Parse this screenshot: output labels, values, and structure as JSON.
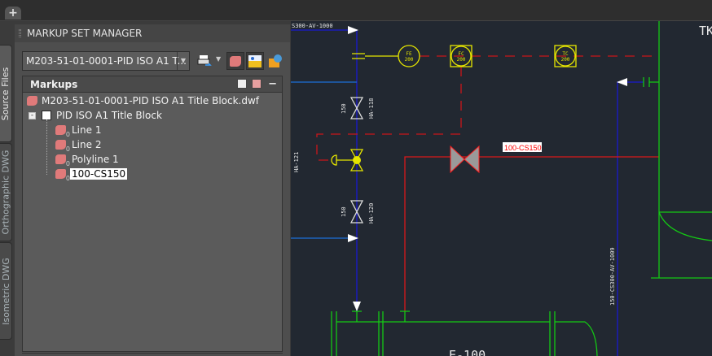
{
  "window": {
    "new_tab_label": "+"
  },
  "side_tabs": [
    {
      "label": "Source Files",
      "active": true
    },
    {
      "label": "Orthographic DWG",
      "active": false
    },
    {
      "label": "Isometric DWG",
      "active": false
    }
  ],
  "panel": {
    "title": "MARKUP SET MANAGER",
    "set_select": {
      "value": "M203-51-01-0001-PID ISO A1 T..."
    },
    "toolbar": [
      "publish-icon",
      "markup-icon",
      "view-sheet-icon",
      "republish-icon"
    ],
    "markups": {
      "header": "Markups",
      "collapse_label": "−",
      "tree": {
        "file": "M203-51-01-0001-PID ISO A1 Title Block.dwf",
        "sheet": "PID ISO A1 Title Block",
        "items": [
          "Line 1",
          "Line 2",
          "Polyline 1",
          "100-CS150"
        ],
        "selected": "100-CS150"
      }
    }
  },
  "drawing": {
    "colors": {
      "background": "#222831",
      "process": "#1a1ad0",
      "signal": "#c8161b",
      "instrument": "#e6e600",
      "equipment": "#14c814",
      "markup": "#ff0000"
    },
    "labels": {
      "top_line": "S300-AV-1000",
      "fe": [
        "FE",
        "200"
      ],
      "fc": [
        "FC",
        "200"
      ],
      "tc": [
        "TC",
        "200"
      ],
      "valve1_size": "150",
      "valve1_tag": "HA-118",
      "valve2_tag": "HA-121",
      "valve3_size": "150",
      "valve3_tag": "HA-120",
      "markup_label": "100-CS150",
      "right_line": "150-CS300-AV-1009",
      "vessel": "E-100",
      "tank": "TK"
    }
  }
}
